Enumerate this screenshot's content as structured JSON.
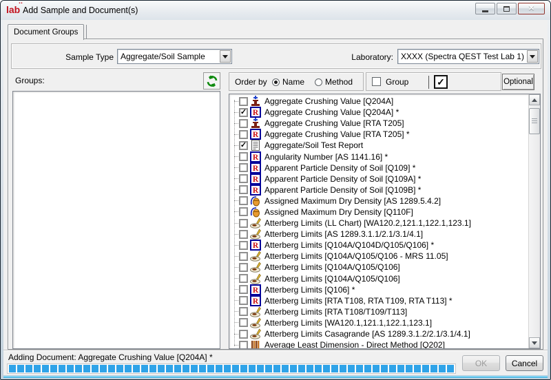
{
  "window": {
    "title": "Add Sample and Document(s)",
    "logo_text": "lab"
  },
  "tab": {
    "label": "Document Groups"
  },
  "filters": {
    "sample_type": {
      "label": "Sample Type",
      "value": "Aggregate/Soil Sample"
    },
    "laboratory": {
      "label": "Laboratory:",
      "value": "XXXX (Spectra QEST Test Lab 1)"
    }
  },
  "groups_panel": {
    "label": "Groups:"
  },
  "order_bar": {
    "label": "Order by",
    "options": [
      {
        "label": "Name",
        "selected": true
      },
      {
        "label": "Method",
        "selected": false
      }
    ],
    "group_checkbox": {
      "label": "Group",
      "checked": false
    },
    "select_all_checkbox": {
      "checked": true
    },
    "optional_button": "Optional"
  },
  "documents": {
    "rows": [
      {
        "checked": false,
        "icon": "crushing-test-icon",
        "label": "Aggregate Crushing Value [Q204A]"
      },
      {
        "checked": true,
        "icon": "report-icon",
        "label": "Aggregate Crushing Value [Q204A] *"
      },
      {
        "checked": false,
        "icon": "crushing-test-icon",
        "label": "Aggregate Crushing Value [RTA T205]"
      },
      {
        "checked": false,
        "icon": "report-icon",
        "label": "Aggregate Crushing Value [RTA T205] *"
      },
      {
        "checked": true,
        "icon": "test-report-icon",
        "label": "Aggregate/Soil Test Report"
      },
      {
        "checked": false,
        "icon": "report-icon",
        "label": "Angularity Number [AS 1141.16] *"
      },
      {
        "checked": false,
        "icon": "report-icon",
        "label": "Apparent Particle Density of Soil [Q109] *"
      },
      {
        "checked": false,
        "icon": "report-icon",
        "label": "Apparent Particle Density of Soil [Q109A] *"
      },
      {
        "checked": false,
        "icon": "report-icon",
        "label": "Apparent Particle Density of Soil [Q109B] *"
      },
      {
        "checked": false,
        "icon": "density-gauge-icon",
        "label": "Assigned Maximum Dry Density [AS 1289.5.4.2]"
      },
      {
        "checked": false,
        "icon": "density-gauge-icon",
        "label": "Assigned Maximum Dry Density [Q110F]"
      },
      {
        "checked": false,
        "icon": "casagrande-dish-icon",
        "label": "Atterberg Limits (LL Chart) [WA120.2,121.1,122.1,123.1]"
      },
      {
        "checked": false,
        "icon": "casagrande-dish-icon",
        "label": "Atterberg Limits [AS 1289.3.1.1/2.1/3.1/4.1]"
      },
      {
        "checked": false,
        "icon": "report-icon",
        "label": "Atterberg Limits [Q104A/Q104D/Q105/Q106] *"
      },
      {
        "checked": false,
        "icon": "casagrande-dish-icon",
        "label": "Atterberg Limits [Q104A/Q105/Q106 - MRS 11.05]"
      },
      {
        "checked": false,
        "icon": "casagrande-dish-icon",
        "label": "Atterberg Limits [Q104A/Q105/Q106]"
      },
      {
        "checked": false,
        "icon": "casagrande-dish-icon",
        "label": "Atterberg Limits [Q104A/Q105/Q106]"
      },
      {
        "checked": false,
        "icon": "report-icon",
        "label": "Atterberg Limits [Q106] *"
      },
      {
        "checked": false,
        "icon": "report-icon",
        "label": "Atterberg Limits [RTA T108, RTA T109, RTA T113] *"
      },
      {
        "checked": false,
        "icon": "casagrande-dish-icon",
        "label": "Atterberg Limits [RTA T108/T109/T113]"
      },
      {
        "checked": false,
        "icon": "casagrande-dish-icon",
        "label": "Atterberg Limits [WA120.1,121.1,122.1,123.1]"
      },
      {
        "checked": false,
        "icon": "casagrande-dish-icon",
        "label": "Atterberg Limits Casagrande [AS 1289.3.1.2/2.1/3.1/4.1]"
      },
      {
        "checked": false,
        "icon": "dimension-bars-icon",
        "label": "Average Least Dimension - Direct Method [Q202]"
      }
    ]
  },
  "status": {
    "text": "Adding Document: Aggregate Crushing Value [Q204A] *",
    "progress": {
      "blocks": 54,
      "percent": 100,
      "color": "#2fa3e8"
    }
  },
  "footer": {
    "ok": "OK",
    "ok_enabled": false,
    "cancel": "Cancel"
  },
  "colors": {
    "progress_block": "#2fa3e8",
    "close_button": "#cd5241",
    "report_letter": "#cc1111",
    "refresh_green": "#0f8a0f"
  }
}
